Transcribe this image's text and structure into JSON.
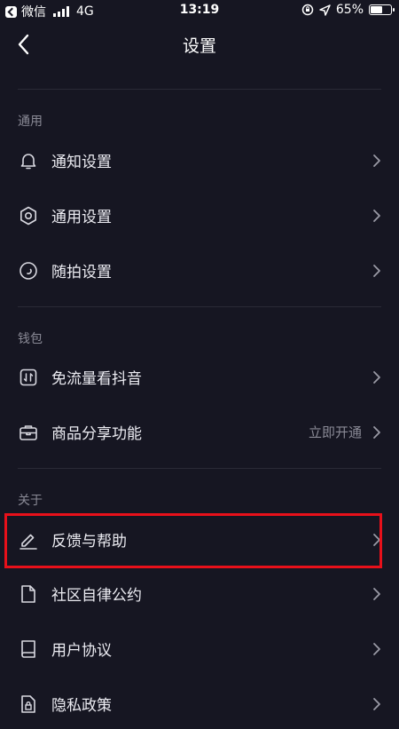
{
  "statusbar": {
    "back_app": "微信",
    "network": "4G",
    "time": "13:19",
    "battery": "65%",
    "battery_level": 0.65
  },
  "nav": {
    "title": "设置"
  },
  "sections": {
    "general": {
      "title": "通用",
      "items": [
        {
          "label": "通知设置",
          "icon": "bell-icon"
        },
        {
          "label": "通用设置",
          "icon": "gear-icon"
        },
        {
          "label": "随拍设置",
          "icon": "circle-icon"
        }
      ]
    },
    "wallet": {
      "title": "钱包",
      "items": [
        {
          "label": "免流量看抖音",
          "icon": "data-card-icon"
        },
        {
          "label": "商品分享功能",
          "icon": "briefcase-icon",
          "value": "立即开通"
        }
      ]
    },
    "about": {
      "title": "关于",
      "items": [
        {
          "label": "反馈与帮助",
          "icon": "edit-icon"
        },
        {
          "label": "社区自律公约",
          "icon": "document-icon"
        },
        {
          "label": "用户协议",
          "icon": "book-icon"
        },
        {
          "label": "隐私政策",
          "icon": "lock-icon"
        }
      ]
    }
  },
  "colors": {
    "background": "#161622",
    "text": "#ececf2",
    "muted": "#8a8a96",
    "highlight": "#e8101a"
  }
}
